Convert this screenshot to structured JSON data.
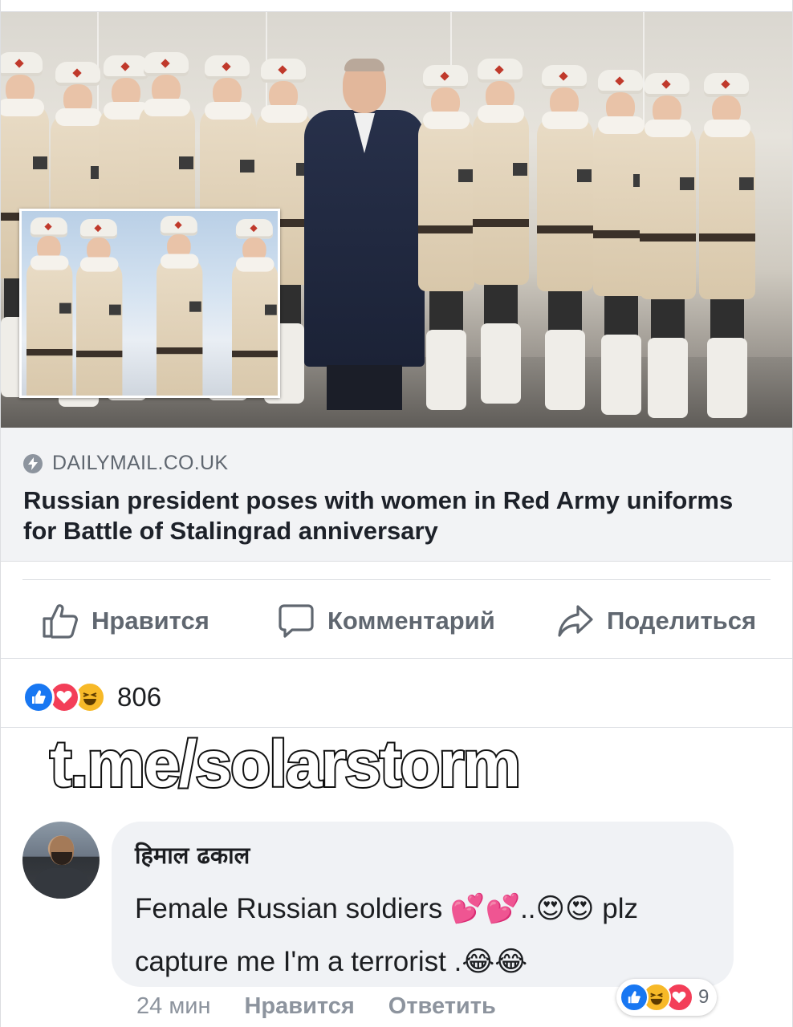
{
  "link_preview": {
    "domain": "DAILYMAIL.CO.UK",
    "title": "Russian president poses with women in Red Army uniforms for Battle of Stalingrad anniversary",
    "source_icon": "bolt-icon"
  },
  "actions": {
    "like_label": "Нравится",
    "comment_label": "Комментарий",
    "share_label": "Поделиться"
  },
  "reactions": {
    "types": [
      "like",
      "love",
      "haha"
    ],
    "count": "806"
  },
  "watermark": "t.me/solarstorm",
  "comment": {
    "author": "हिमाल ढकाल",
    "text": "Female Russian  soldiers 💕💕..😍😍 plz capture  me I'm a terrorist .😂😂",
    "time": "24 мин",
    "like_label": "Нравится",
    "reply_label": "Ответить",
    "reactions": {
      "types": [
        "like",
        "haha",
        "love"
      ],
      "count": "9"
    }
  },
  "colors": {
    "like_blue": "#1877f2",
    "love_red": "#f33e58",
    "haha_yellow": "#f7b928",
    "secondary_text": "#606770",
    "bubble_bg": "#f0f2f5"
  }
}
